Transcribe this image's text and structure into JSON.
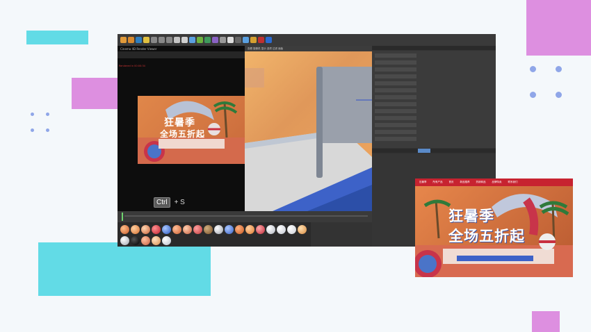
{
  "render_window": {
    "title": "Cinema 4D Render Viewer",
    "info_line": "Rendered in 00:00:34",
    "banner": {
      "line1": "狂暑季",
      "line2": "全场五折起"
    }
  },
  "shortcut": {
    "key": "Ctrl",
    "combo": "+ S"
  },
  "viewport": {
    "header": "查看 摄像机 显示 选项 过滤 面板"
  },
  "banner_card": {
    "nav": [
      "狂暑季",
      "所有产品",
      "首页",
      "新品推荐",
      "热销商品",
      "品牌特卖",
      "联系我们"
    ],
    "line1": "狂暑季",
    "line2": "全场五折起"
  },
  "colors": {
    "teal": "#62dbe6",
    "pink": "#dd8fe0",
    "dot_blue": "#8fa6e8"
  }
}
